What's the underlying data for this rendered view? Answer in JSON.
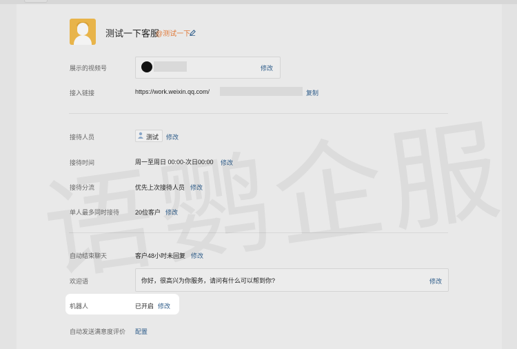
{
  "profile": {
    "name": "测试一下客服",
    "handle": "@测试一下"
  },
  "rows": {
    "video_label": "展示的视频号",
    "video_edit": "修改",
    "link_label": "接入链接",
    "link_value": "https://work.weixin.qq.com/",
    "link_copy": "复制",
    "staff_label": "接待人员",
    "staff_name": "测试",
    "staff_edit": "修改",
    "time_label": "接待时间",
    "time_value": "周一至周日 00:00-次日00:00",
    "time_edit": "修改",
    "split_label": "接待分流",
    "split_value": "优先上次接待人员",
    "split_edit": "修改",
    "max_label": "单人最多同时接待",
    "max_value": "20位客户",
    "max_edit": "修改",
    "auto_end_label": "自动结束聊天",
    "auto_end_value": "客户48小时未回复",
    "auto_end_edit": "修改",
    "welcome_label": "欢迎语",
    "welcome_value": "你好，很高兴为你服务，请问有什么可以帮到你?",
    "welcome_edit": "修改",
    "robot_label": "机器人",
    "robot_value": "已开启",
    "robot_edit": "修改",
    "survey_label": "自动发送满意度评价",
    "survey_value": "配置"
  },
  "watermark": "语鹦企服",
  "icons": [
    "pencil-icon",
    "user-icon"
  ]
}
